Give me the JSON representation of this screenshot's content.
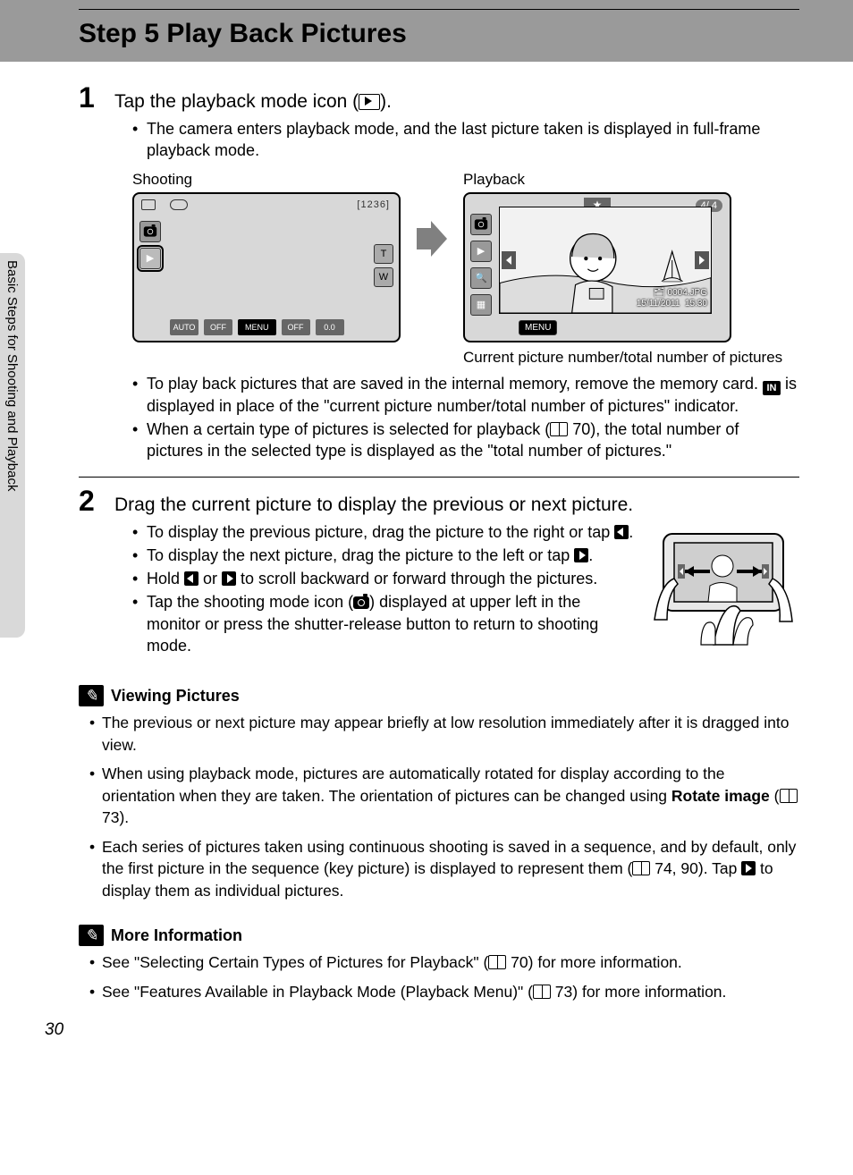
{
  "header": {
    "title": "Step 5 Play Back Pictures"
  },
  "side_tab": "Basic Steps for Shooting and Playback",
  "page_number": "30",
  "step1": {
    "num": "1",
    "heading_a": "Tap the playback mode icon (",
    "heading_b": ").",
    "b1": "The camera enters playback mode, and the last picture taken is displayed in full-frame playback mode.",
    "label_shooting": "Shooting",
    "label_playback": "Playback",
    "shooting_counter": "[1236]",
    "t_label": "T",
    "w_label": "W",
    "btn_auto": "AUTO",
    "btn_off": "OFF",
    "btn_menu": "MENU",
    "btn_off2": "OFF",
    "btn_ev": "0.0",
    "pb_count": "4/   4",
    "pb_star": "★",
    "pb_file": "0004.JPG",
    "pb_date": "15/11/2011",
    "pb_time": "15:30",
    "pb_menu": "MENU",
    "caption": "Current picture number/total number of pictures",
    "b2a": "To play back pictures that are saved in the internal memory, remove the memory card. ",
    "b2b": " is displayed in place of the \"current picture number/total number of pictures\" indicator.",
    "b3a": "When a certain type of pictures is selected for playback (",
    "b3b": " 70), the total number of pictures in the selected type is displayed as the \"total number of pictures.\""
  },
  "step2": {
    "num": "2",
    "heading": "Drag the current picture to display the previous or next picture.",
    "b1a": "To display the previous picture, drag the picture to the right or tap ",
    "b1b": ".",
    "b2a": "To display the next picture, drag the picture to the left or tap ",
    "b2b": ".",
    "b3a": "Hold ",
    "b3b": " or ",
    "b3c": " to scroll backward or forward through the pictures.",
    "b4a": "Tap the shooting mode icon (",
    "b4b": ") displayed at upper left in the monitor or press the shutter-release button to return to shooting mode."
  },
  "note_view": {
    "title": "Viewing Pictures",
    "b1": "The previous or next picture may appear briefly at low resolution immediately after it is dragged into view.",
    "b2a": "When using playback mode, pictures are automatically rotated for display according to the orientation when they are taken. The orientation of pictures can be changed using ",
    "b2_bold": "Rotate image",
    "b2b": " (",
    "b2c": " 73).",
    "b3a": "Each series of pictures taken using continuous shooting is saved in a sequence, and by default, only the first picture in the sequence (key picture) is displayed to represent them (",
    "b3b": " 74, 90). Tap ",
    "b3c": " to display them as individual pictures."
  },
  "note_more": {
    "title": "More Information",
    "b1a": "See \"Selecting Certain Types of Pictures for Playback\" (",
    "b1b": " 70) for more information.",
    "b2a": "See \"Features Available in Playback Mode (Playback Menu)\" (",
    "b2b": " 73) for more information."
  }
}
